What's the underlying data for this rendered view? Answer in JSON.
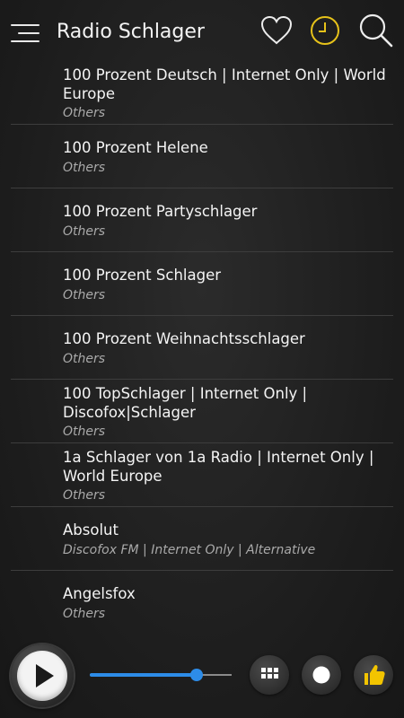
{
  "header": {
    "title": "Radio Schlager",
    "icons": [
      "menu-icon",
      "heart-icon",
      "clock-icon",
      "search-icon"
    ],
    "clock_color": "#e6c21a"
  },
  "stations": [
    {
      "name": "100 Prozent Deutsch | Internet Only | World Europe",
      "genre": "Others"
    },
    {
      "name": "100 Prozent Helene",
      "genre": "Others"
    },
    {
      "name": "100 Prozent Partyschlager",
      "genre": "Others"
    },
    {
      "name": "100 Prozent Schlager",
      "genre": "Others"
    },
    {
      "name": "100 Prozent Weihnachtsschlager",
      "genre": "Others"
    },
    {
      "name": "100 TopSchlager | Internet Only | Discofox|Schlager",
      "genre": "Others"
    },
    {
      "name": "1a Schlager von 1a Radio | Internet Only | World Europe",
      "genre": "Others"
    },
    {
      "name": "Absolut",
      "genre": "Discofox FM | Internet Only | Alternative"
    },
    {
      "name": "Angelsfox",
      "genre": "Others"
    }
  ],
  "player": {
    "volume_fraction": 0.75,
    "accent_color": "#2d8ce8",
    "thumb_icon_color": "#f2c400",
    "buttons": [
      "play-icon",
      "grid-icon",
      "record-icon",
      "thumbs-up-icon"
    ]
  }
}
